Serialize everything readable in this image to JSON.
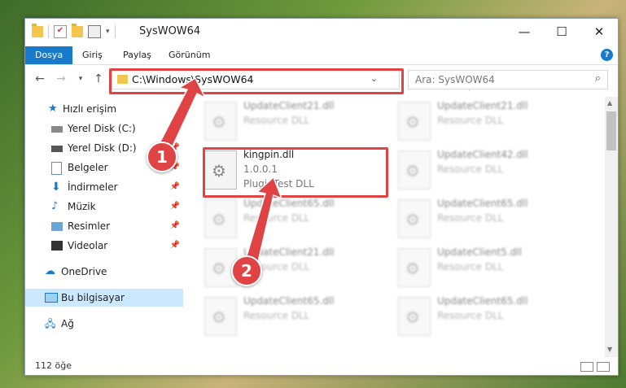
{
  "window": {
    "title": "SysWOW64"
  },
  "ribbon": {
    "tabs": [
      "Dosya",
      "Giriş",
      "Paylaş",
      "Görünüm"
    ],
    "help": "?"
  },
  "address": {
    "path": "C:\\Windows\\SysWOW64",
    "search_placeholder": "Ara: SysWOW64"
  },
  "sidebar": {
    "items": [
      {
        "label": "Hızlı erişim",
        "icon": "star-icon",
        "pinned": false
      },
      {
        "label": "Yerel Disk (C:)",
        "icon": "drive-icon",
        "pinned": true
      },
      {
        "label": "Yerel Disk (D:)",
        "icon": "drive-icon",
        "pinned": true
      },
      {
        "label": "Belgeler",
        "icon": "documents-icon",
        "pinned": true
      },
      {
        "label": "İndirmeler",
        "icon": "download-icon",
        "pinned": true
      },
      {
        "label": "Müzik",
        "icon": "music-icon",
        "pinned": true
      },
      {
        "label": "Resimler",
        "icon": "pictures-icon",
        "pinned": true
      },
      {
        "label": "Videolar",
        "icon": "video-icon",
        "pinned": true
      },
      {
        "label": "OneDrive",
        "icon": "cloud-icon",
        "pinned": false
      },
      {
        "label": "Bu bilgisayar",
        "icon": "computer-icon",
        "pinned": false
      },
      {
        "label": "Ağ",
        "icon": "network-icon",
        "pinned": false
      }
    ]
  },
  "files": [
    {
      "name": "UpdateClient21.dll",
      "desc": "Resource DLL",
      "ver": ""
    },
    {
      "name": "UpdateClient21.dll",
      "desc": "Resource DLL",
      "ver": ""
    },
    {
      "name": "kingpin.dll",
      "desc": "PluginTest DLL",
      "ver": "1.0.0.1"
    },
    {
      "name": "UpdateClient42.dll",
      "desc": "Resource DLL",
      "ver": ""
    },
    {
      "name": "UpdateClient65.dll",
      "desc": "Resource DLL",
      "ver": ""
    },
    {
      "name": "UpdateClient65.dll",
      "desc": "Resource DLL",
      "ver": ""
    },
    {
      "name": "UpdateClient21.dll",
      "desc": "Resource DLL",
      "ver": ""
    },
    {
      "name": "UpdateClient5.dll",
      "desc": "Resource DLL",
      "ver": ""
    },
    {
      "name": "UpdateClient65.dll",
      "desc": "Resource DLL",
      "ver": ""
    },
    {
      "name": "UpdateClient65.dll",
      "desc": "Resource DLL",
      "ver": ""
    }
  ],
  "status": {
    "count": "112 öğe"
  },
  "annotations": {
    "step1": "1",
    "step2": "2"
  },
  "colors": {
    "accent": "#1979ca",
    "highlight": "#e04343"
  }
}
